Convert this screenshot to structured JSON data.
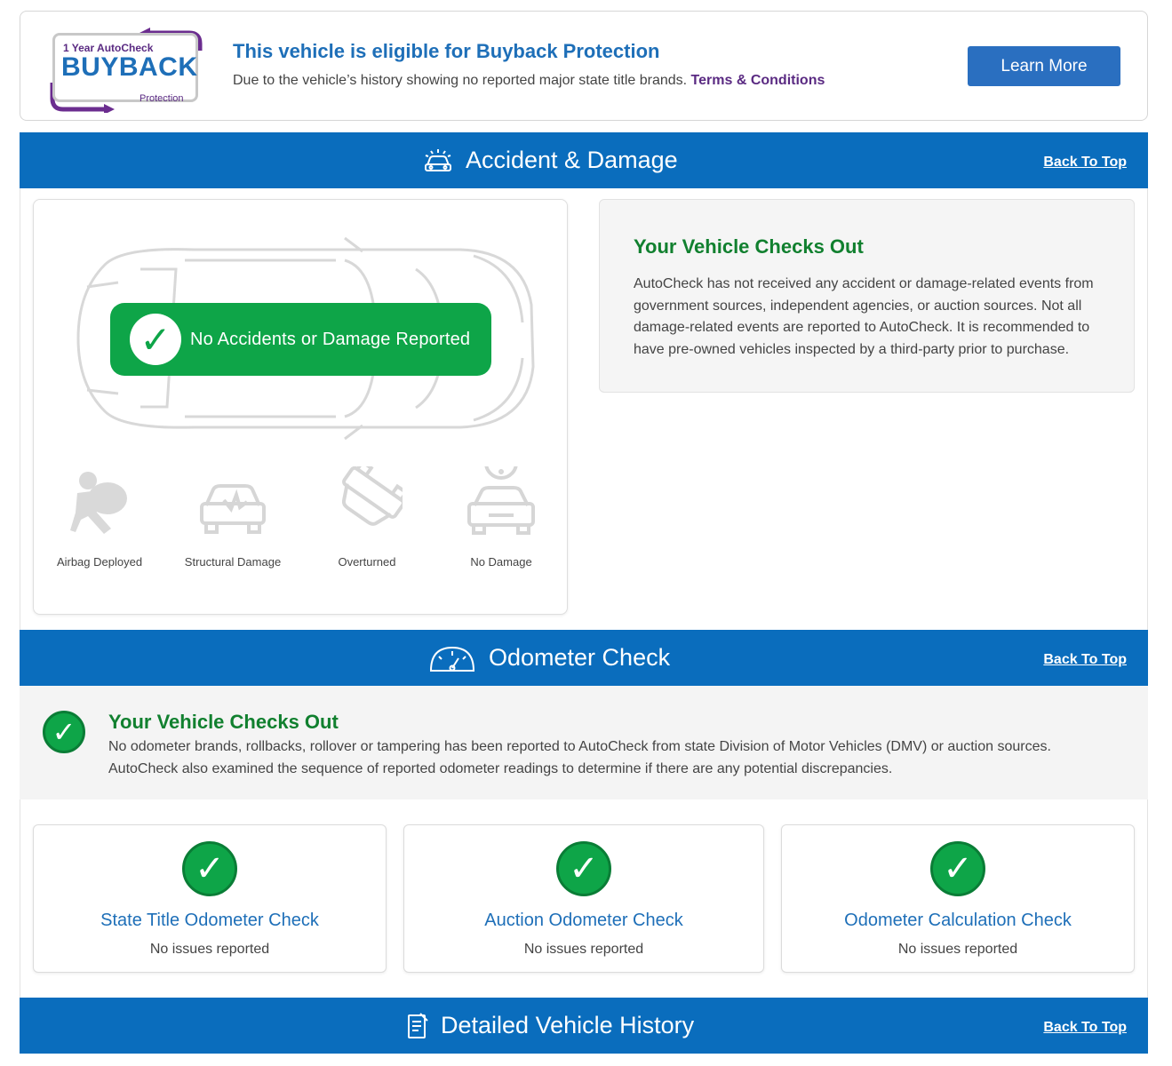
{
  "buyback": {
    "logo_small": "1 Year AutoCheck",
    "logo_big": "BUYBACK",
    "logo_protection": "Protection",
    "title": "This vehicle is eligible for Buyback Protection",
    "description": "Due to the vehicle’s history showing no reported major state title brands.",
    "terms_link": "Terms & Conditions",
    "learn_more": "Learn More"
  },
  "accident": {
    "section_title": "Accident & Damage",
    "back_to_top": "Back To Top",
    "status_pill": "No Accidents or Damage Reported",
    "damage_types": [
      {
        "label": "Airbag Deployed",
        "icon": "airbag-icon"
      },
      {
        "label": "Structural Damage",
        "icon": "structural-damage-icon"
      },
      {
        "label": "Overturned",
        "icon": "overturned-car-icon"
      },
      {
        "label": "No Damage",
        "icon": "no-damage-icon"
      }
    ],
    "info_title": "Your Vehicle Checks Out",
    "info_text": "AutoCheck has not received any accident or damage-related events from government sources, independent agencies, or auction sources. Not all damage-related events are reported to AutoCheck. It is recommended to have pre-owned vehicles inspected by a third-party prior to purchase."
  },
  "odometer": {
    "section_title": "Odometer Check",
    "back_to_top": "Back To Top",
    "summary_title": "Your Vehicle Checks Out",
    "summary_text": "No odometer brands, rollbacks, rollover or tampering has been reported to AutoCheck from state Division of Motor Vehicles (DMV) or auction sources. AutoCheck also examined the sequence of reported odometer readings to determine if there are any potential discrepancies.",
    "checks": [
      {
        "title": "State Title Odometer Check",
        "status": "No issues reported"
      },
      {
        "title": "Auction Odometer Check",
        "status": "No issues reported"
      },
      {
        "title": "Odometer Calculation Check",
        "status": "No issues reported"
      }
    ]
  },
  "history": {
    "section_title": "Detailed Vehicle History",
    "back_to_top": "Back To Top"
  },
  "colors": {
    "brand_blue": "#0a6dbd",
    "success_green": "#0ea548",
    "heading_green": "#11802f",
    "link_purple": "#5a2a82"
  }
}
